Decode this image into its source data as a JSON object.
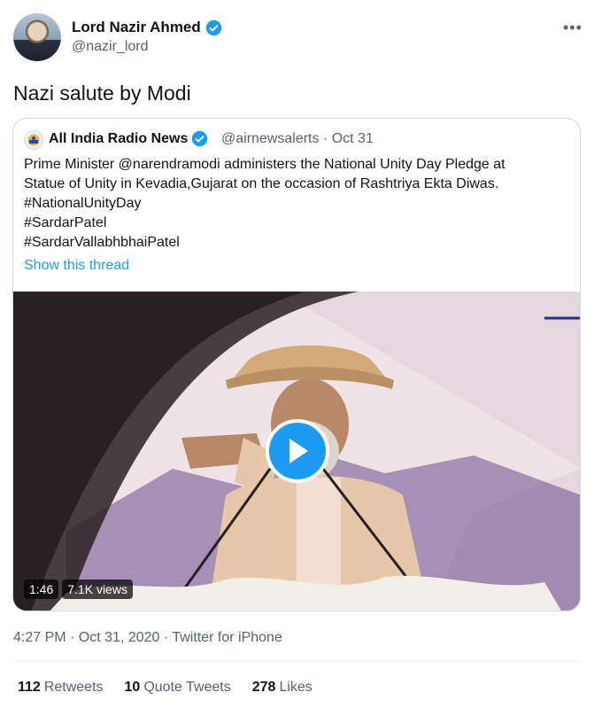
{
  "author": {
    "name": "Lord Nazir Ahmed",
    "handle": "@nazir_lord",
    "verified": true
  },
  "more_menu": "•••",
  "tweet_text": "Nazi salute by Modi",
  "quoted_tweet": {
    "author_name": "All India Radio News",
    "verified": true,
    "meta": "@airnewsalerts · Oct 31",
    "lines": [
      "Prime Minister @narendramodi administers the National Unity Day Pledge at",
      "Statue of Unity in Kevadia,Gujarat on the occasion of Rashtriya Ekta Diwas.",
      "#NationalUnityDay",
      "#SardarPatel",
      "#SardarVallabhbhaiPatel"
    ],
    "show_thread": "Show this thread",
    "video": {
      "duration": "1:46",
      "views": "7.1K views"
    }
  },
  "timestamp": "4:27 PM · Oct 31, 2020 · Twitter for iPhone",
  "stats": {
    "retweets_count": "112",
    "retweets_label": "Retweets",
    "quotes_count": "10",
    "quotes_label": "Quote Tweets",
    "likes_count": "278",
    "likes_label": "Likes"
  },
  "colors": {
    "accent": "#1d9bf0",
    "muted": "#536471",
    "border": "#cfd9de"
  }
}
